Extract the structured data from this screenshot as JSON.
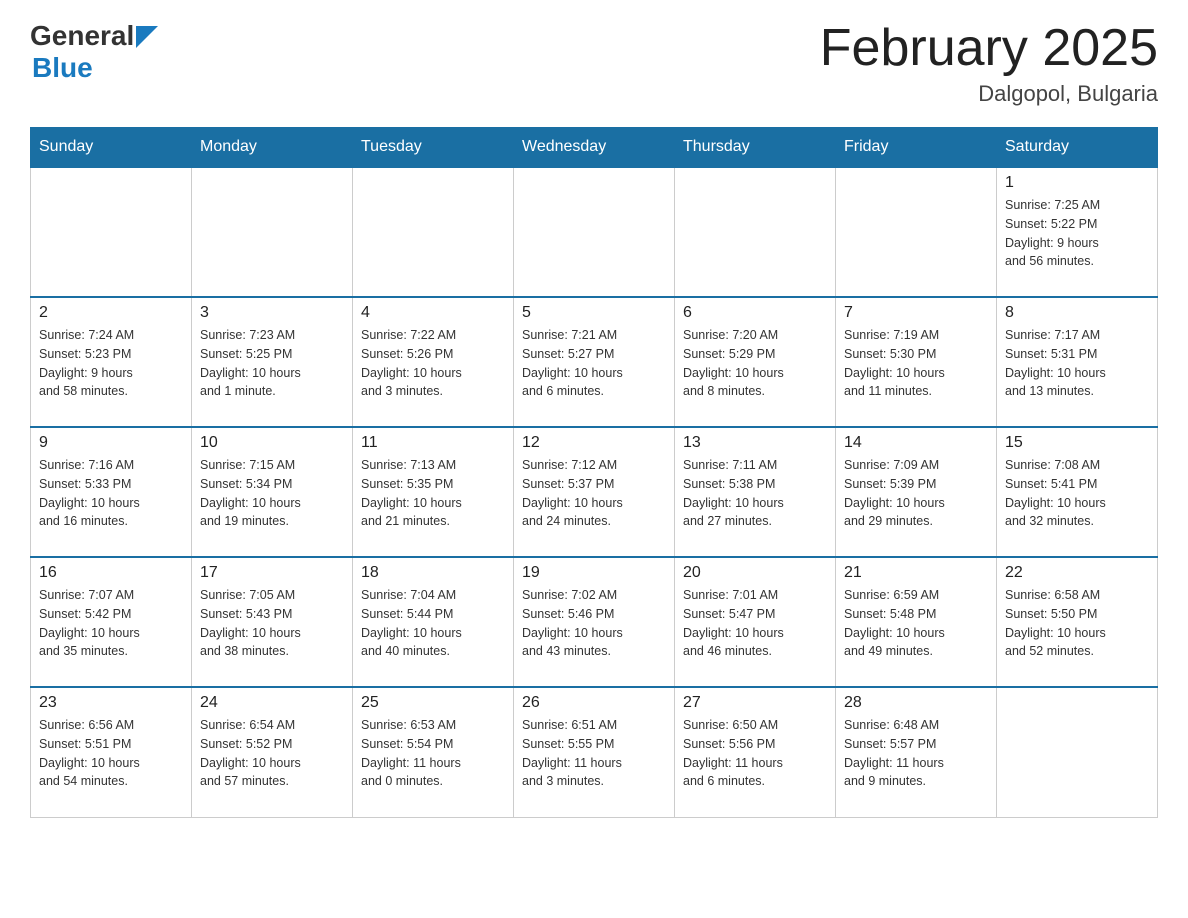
{
  "header": {
    "title": "February 2025",
    "location": "Dalgopol, Bulgaria",
    "logo_general": "General",
    "logo_blue": "Blue"
  },
  "weekdays": [
    "Sunday",
    "Monday",
    "Tuesday",
    "Wednesday",
    "Thursday",
    "Friday",
    "Saturday"
  ],
  "weeks": [
    [
      {
        "day": "",
        "info": ""
      },
      {
        "day": "",
        "info": ""
      },
      {
        "day": "",
        "info": ""
      },
      {
        "day": "",
        "info": ""
      },
      {
        "day": "",
        "info": ""
      },
      {
        "day": "",
        "info": ""
      },
      {
        "day": "1",
        "info": "Sunrise: 7:25 AM\nSunset: 5:22 PM\nDaylight: 9 hours\nand 56 minutes."
      }
    ],
    [
      {
        "day": "2",
        "info": "Sunrise: 7:24 AM\nSunset: 5:23 PM\nDaylight: 9 hours\nand 58 minutes."
      },
      {
        "day": "3",
        "info": "Sunrise: 7:23 AM\nSunset: 5:25 PM\nDaylight: 10 hours\nand 1 minute."
      },
      {
        "day": "4",
        "info": "Sunrise: 7:22 AM\nSunset: 5:26 PM\nDaylight: 10 hours\nand 3 minutes."
      },
      {
        "day": "5",
        "info": "Sunrise: 7:21 AM\nSunset: 5:27 PM\nDaylight: 10 hours\nand 6 minutes."
      },
      {
        "day": "6",
        "info": "Sunrise: 7:20 AM\nSunset: 5:29 PM\nDaylight: 10 hours\nand 8 minutes."
      },
      {
        "day": "7",
        "info": "Sunrise: 7:19 AM\nSunset: 5:30 PM\nDaylight: 10 hours\nand 11 minutes."
      },
      {
        "day": "8",
        "info": "Sunrise: 7:17 AM\nSunset: 5:31 PM\nDaylight: 10 hours\nand 13 minutes."
      }
    ],
    [
      {
        "day": "9",
        "info": "Sunrise: 7:16 AM\nSunset: 5:33 PM\nDaylight: 10 hours\nand 16 minutes."
      },
      {
        "day": "10",
        "info": "Sunrise: 7:15 AM\nSunset: 5:34 PM\nDaylight: 10 hours\nand 19 minutes."
      },
      {
        "day": "11",
        "info": "Sunrise: 7:13 AM\nSunset: 5:35 PM\nDaylight: 10 hours\nand 21 minutes."
      },
      {
        "day": "12",
        "info": "Sunrise: 7:12 AM\nSunset: 5:37 PM\nDaylight: 10 hours\nand 24 minutes."
      },
      {
        "day": "13",
        "info": "Sunrise: 7:11 AM\nSunset: 5:38 PM\nDaylight: 10 hours\nand 27 minutes."
      },
      {
        "day": "14",
        "info": "Sunrise: 7:09 AM\nSunset: 5:39 PM\nDaylight: 10 hours\nand 29 minutes."
      },
      {
        "day": "15",
        "info": "Sunrise: 7:08 AM\nSunset: 5:41 PM\nDaylight: 10 hours\nand 32 minutes."
      }
    ],
    [
      {
        "day": "16",
        "info": "Sunrise: 7:07 AM\nSunset: 5:42 PM\nDaylight: 10 hours\nand 35 minutes."
      },
      {
        "day": "17",
        "info": "Sunrise: 7:05 AM\nSunset: 5:43 PM\nDaylight: 10 hours\nand 38 minutes."
      },
      {
        "day": "18",
        "info": "Sunrise: 7:04 AM\nSunset: 5:44 PM\nDaylight: 10 hours\nand 40 minutes."
      },
      {
        "day": "19",
        "info": "Sunrise: 7:02 AM\nSunset: 5:46 PM\nDaylight: 10 hours\nand 43 minutes."
      },
      {
        "day": "20",
        "info": "Sunrise: 7:01 AM\nSunset: 5:47 PM\nDaylight: 10 hours\nand 46 minutes."
      },
      {
        "day": "21",
        "info": "Sunrise: 6:59 AM\nSunset: 5:48 PM\nDaylight: 10 hours\nand 49 minutes."
      },
      {
        "day": "22",
        "info": "Sunrise: 6:58 AM\nSunset: 5:50 PM\nDaylight: 10 hours\nand 52 minutes."
      }
    ],
    [
      {
        "day": "23",
        "info": "Sunrise: 6:56 AM\nSunset: 5:51 PM\nDaylight: 10 hours\nand 54 minutes."
      },
      {
        "day": "24",
        "info": "Sunrise: 6:54 AM\nSunset: 5:52 PM\nDaylight: 10 hours\nand 57 minutes."
      },
      {
        "day": "25",
        "info": "Sunrise: 6:53 AM\nSunset: 5:54 PM\nDaylight: 11 hours\nand 0 minutes."
      },
      {
        "day": "26",
        "info": "Sunrise: 6:51 AM\nSunset: 5:55 PM\nDaylight: 11 hours\nand 3 minutes."
      },
      {
        "day": "27",
        "info": "Sunrise: 6:50 AM\nSunset: 5:56 PM\nDaylight: 11 hours\nand 6 minutes."
      },
      {
        "day": "28",
        "info": "Sunrise: 6:48 AM\nSunset: 5:57 PM\nDaylight: 11 hours\nand 9 minutes."
      },
      {
        "day": "",
        "info": ""
      }
    ]
  ]
}
